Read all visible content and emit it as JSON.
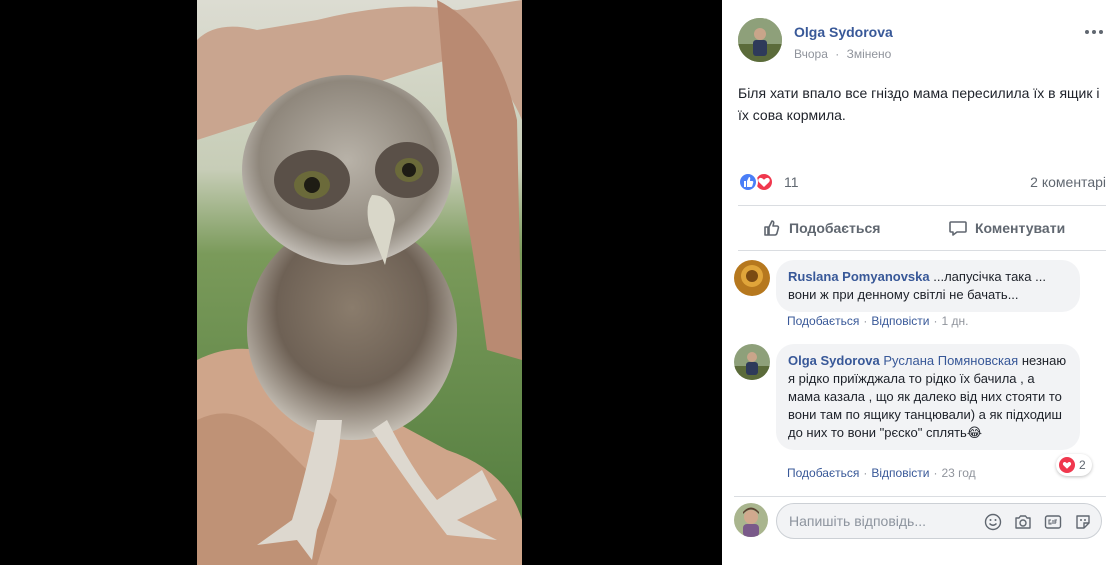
{
  "photo": {
    "description_icon": "owlet-photo"
  },
  "post": {
    "author": "Olga Sydorova",
    "time": "Вчора",
    "edited": "Змінено",
    "text": "Біля хати впало все гніздо мама пересилила їх в ящик і їх сова кормила.",
    "reaction_count": "11",
    "comment_count": "2 коментарі",
    "like_label": "Подобається",
    "comment_label": "Коментувати"
  },
  "comments": [
    {
      "author": "Ruslana Pomyanovska",
      "text": "...лапусічка така ... вони ж при денному світлі не бачать...",
      "like_label": "Подобається",
      "reply_label": "Відповісти",
      "time": "1 дн."
    },
    {
      "author": "Olga Sydorova",
      "tag": "Руслана Помяновская",
      "text": "незнаю я рідко приїжджала то рідко їх бачила , а мама казала , що як далеко від них стояти то вони там по ящику танцювали) а як підходиш до них то вони \"рєско\" сплять😂",
      "like_label": "Подобається",
      "reply_label": "Відповісти",
      "time": "23 год",
      "reaction_count": "2"
    }
  ],
  "reply": {
    "placeholder": "Напишіть відповідь..."
  },
  "colors": {
    "link": "#385898",
    "like": "#4a7ef7",
    "love": "#f0384e",
    "muted": "#90949c"
  }
}
